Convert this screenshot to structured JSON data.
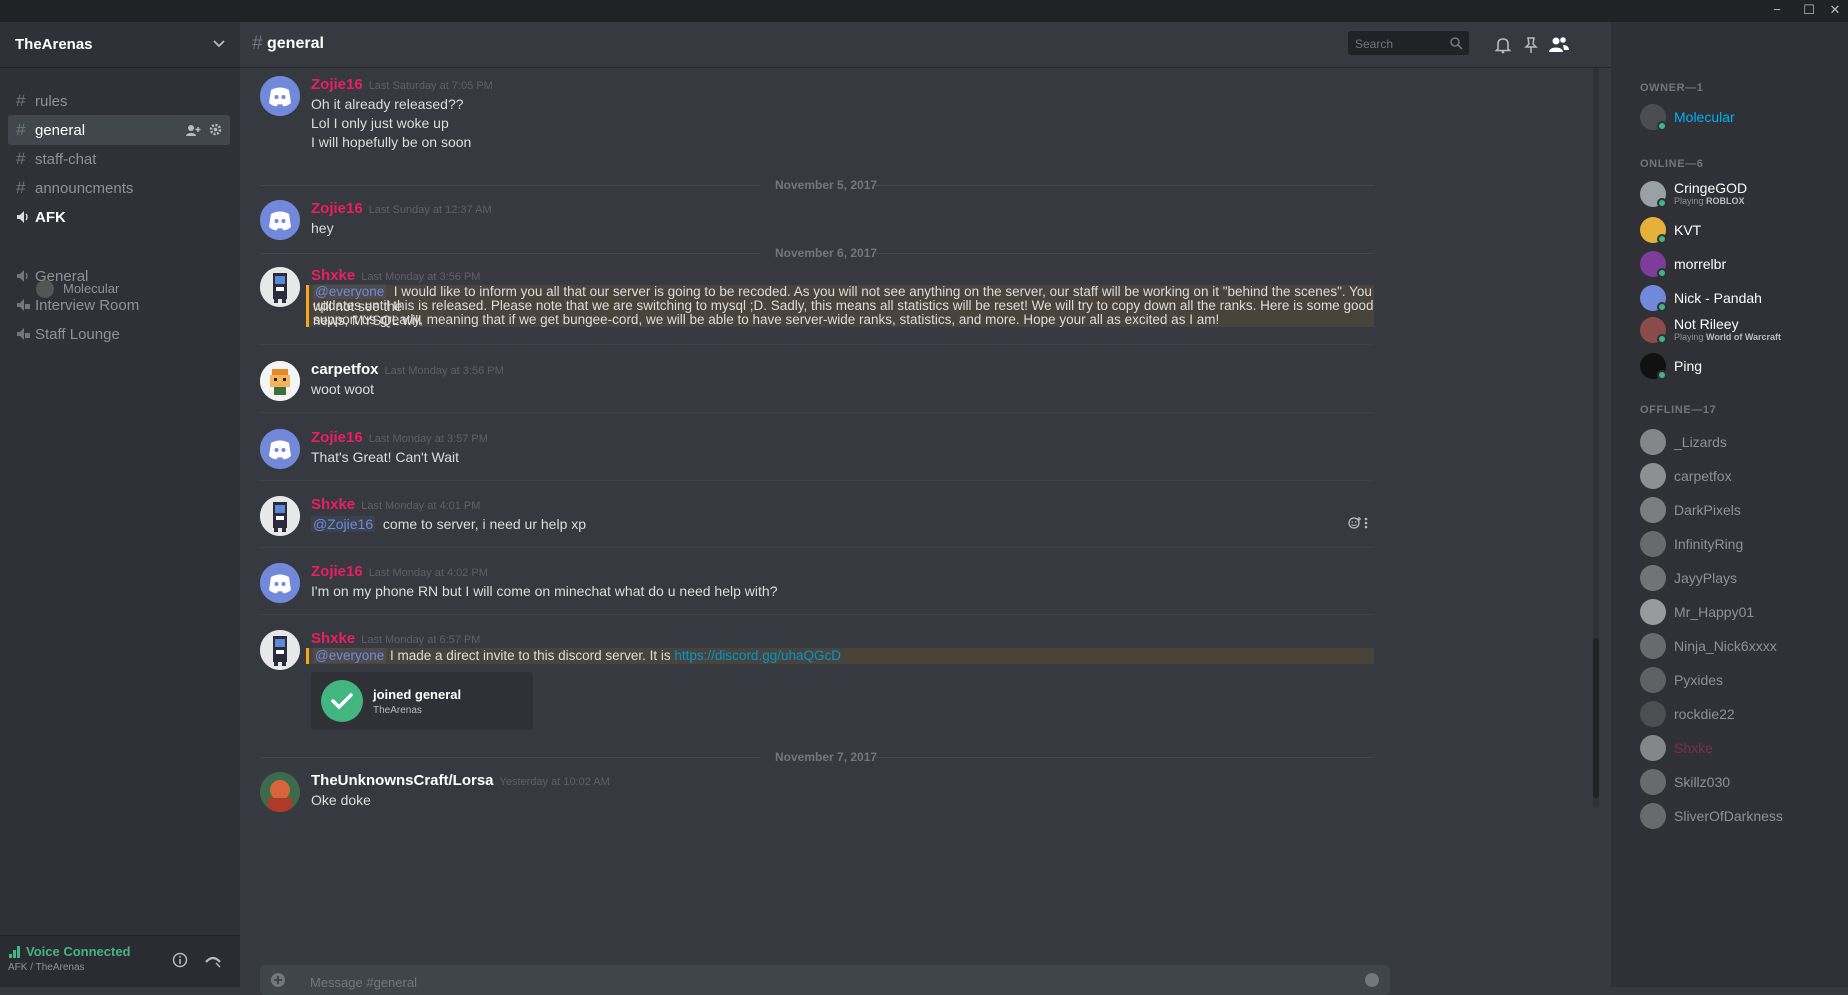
{
  "window": {
    "minimize": "−",
    "maximize": "☐",
    "close": "✕"
  },
  "guild": {
    "name": "TheArenas"
  },
  "channels": [
    {
      "label": "rules"
    },
    {
      "label": "general"
    },
    {
      "label": "staff-chat"
    },
    {
      "label": "announcments"
    },
    {
      "label": "AFK"
    },
    {
      "label": "General"
    },
    {
      "label": "Interview Room"
    },
    {
      "label": "Staff Lounge"
    }
  ],
  "voice_users": [
    {
      "name": "Molecular"
    }
  ],
  "voice_status": {
    "title": "Voice Connected",
    "subtitle": "AFK / TheArenas"
  },
  "header": {
    "channel": "general",
    "search_placeholder": "Search"
  },
  "dates": [
    "November 5, 2017",
    "November 6, 2017",
    "November 7, 2017"
  ],
  "messages": [
    {
      "author": "Zojie16",
      "time": "Last Saturday at 7:05 PM",
      "lines": [
        "Oh it already released??",
        "Lol I only just woke up",
        "I will hopefully be on soon"
      ]
    },
    {
      "author": "Zojie16",
      "time": "Last Sunday at 12:37 AM",
      "lines": [
        "hey"
      ]
    },
    {
      "author": "Shxke",
      "time": "Last Monday at 3:56 PM",
      "mention": "@everyone",
      "lines": [
        "I would like to inform you all that our server is going to be recoded. As you will not see anything on the server, our staff will be working on it \"behind the scenes\". You will not see the",
        "updates until this is released. Please note that we are switching to mysql ;D. Sadly, this means all statistics will be reset! We will try to copy down  all the ranks. Here is some good news, MYSQL will",
        "support us greatly, meaning that if we get bungee-cord, we will be able to have server-wide ranks, statistics, and more. Hope your all as excited as I am!"
      ]
    },
    {
      "author": "carpetfox",
      "time": "Last Monday at 3:56 PM",
      "lines": [
        "woot woot"
      ]
    },
    {
      "author": "Zojie16",
      "time": "Last Monday at 3:57 PM",
      "lines": [
        "That's Great! Can't Wait"
      ]
    },
    {
      "author": "Shxke",
      "time": "Last Monday at 4:01 PM",
      "mention": "@Zojie16",
      "lines": [
        "come to server, i need ur help xp"
      ]
    },
    {
      "author": "Zojie16",
      "time": "Last Monday at 4:02 PM",
      "lines": [
        "I'm on my phone RN but I will come on minechat what do u need help with?"
      ]
    },
    {
      "author": "Shxke",
      "time": "Last Monday at 6:57 PM",
      "mention": "@everyone",
      "lines": [
        "I made a direct invite to this discord server. It is"
      ],
      "link": "https://discord.gg/uhaQGcD",
      "embed": {
        "title": "joined general",
        "subtitle": "TheArenas"
      }
    },
    {
      "author": "TheUnknownsCraft/Lorsa",
      "time": "Yesterday at 10:02 AM",
      "lines": [
        "Oke doke"
      ]
    }
  ],
  "composer": {
    "placeholder": "Message #general"
  },
  "members": {
    "owner_header": "OWNER—1",
    "owner": [
      {
        "name": "Molecular"
      }
    ],
    "online_header": "ONLINE—6",
    "online": [
      {
        "name": "CringeGOD",
        "activity": "Playing",
        "game": "ROBLOX"
      },
      {
        "name": "KVT"
      },
      {
        "name": "morrelbr"
      },
      {
        "name": "Nick - Pandah"
      },
      {
        "name": "Not Rileey",
        "activity": "Playing",
        "game": "World of Warcraft"
      },
      {
        "name": "Ping"
      }
    ],
    "offline_header": "OFFLINE—17",
    "offline": [
      {
        "name": "_Lizards"
      },
      {
        "name": "carpetfox"
      },
      {
        "name": "DarkPixels"
      },
      {
        "name": "InfinityRing"
      },
      {
        "name": "JayyPlays"
      },
      {
        "name": "Mr_Happy01"
      },
      {
        "name": "Ninja_Nick6xxxx"
      },
      {
        "name": "Pyxides"
      },
      {
        "name": "rockdie22"
      },
      {
        "name": "Shxke"
      },
      {
        "name": "Skillz030"
      },
      {
        "name": "SliverOfDarkness"
      }
    ]
  },
  "colors": {
    "author_pink": "#e91e63",
    "owner_blue": "#00b0f4",
    "online_green": "#43b581",
    "mention_blue": "#7289da",
    "link": "#0096cf"
  }
}
